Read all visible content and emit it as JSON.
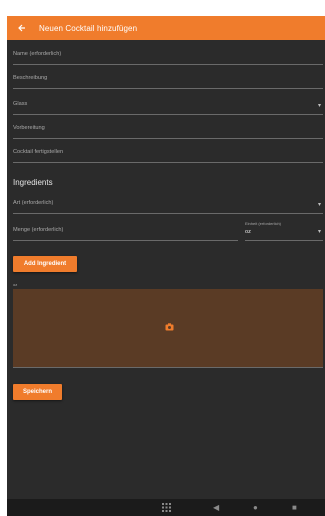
{
  "appbar": {
    "title": "Neuen Cocktail hinzufügen",
    "back_icon": "arrow-left-icon",
    "color": "#f07c2c"
  },
  "form": {
    "name_label": "Name (erforderlich)",
    "description_label": "Beschreibung",
    "glass_label": "Glass",
    "preparation_label": "Vorbereitung",
    "finish_label": "Cocktail fertigstellen"
  },
  "ingredients": {
    "title": "Ingredients",
    "type_label": "Art (erforderlich)",
    "amount_label": "Menge (erforderlich)",
    "unit_label": "Einheit (erforderlich)",
    "unit_value": "oz",
    "add_button": "Add Ingredient",
    "unit_hint": "oz"
  },
  "photo": {
    "icon": "camera-icon",
    "background": "#5a3b25"
  },
  "save_button": "Speichern",
  "navbar": {
    "apps_icon": "apps-grid-icon",
    "back_icon": "nav-back-icon",
    "home_icon": "nav-home-icon",
    "recents_icon": "nav-recents-icon"
  }
}
